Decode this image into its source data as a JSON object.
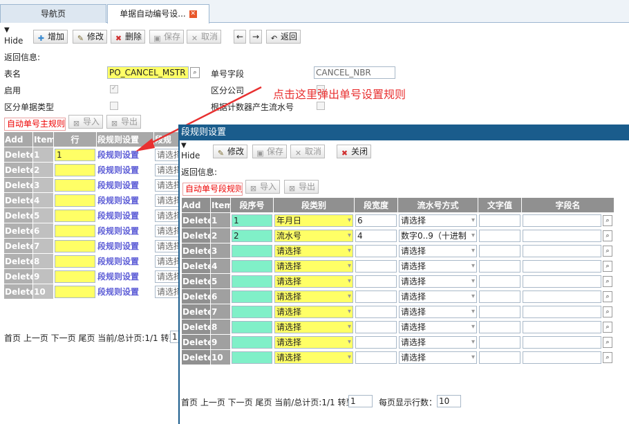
{
  "tabs": [
    {
      "label": "导航页"
    },
    {
      "label": "单据自动编号设..."
    }
  ],
  "toolbar": {
    "hide": "Hide",
    "add": "增加",
    "edit": "修改",
    "delete": "删除",
    "save": "保存",
    "cancel": "取消",
    "back": "返回"
  },
  "form": {
    "return_info": "返回信息:",
    "table_name_label": "表名",
    "table_name_value": "PO_CANCEL_MSTR",
    "number_field_label": "单号字段",
    "number_field_value": "CANCEL_NBR",
    "enabled_label": "启用",
    "distinguish_company_label": "区分公司",
    "distinguish_doc_type_label": "区分单据类型",
    "counter_serial_label": "根据计数器产生流水号"
  },
  "main_subtabs": {
    "auto_rule": "自动单号主规则",
    "import": "导入",
    "export": "导出"
  },
  "main_grid": {
    "headers": [
      "Add",
      "Item",
      "行",
      "段规则设置",
      "段规"
    ],
    "delete_label": "Delete",
    "rule_link": "段规则设置",
    "select_placeholder": "请选择",
    "rows": [
      {
        "item": "1",
        "row": "1"
      },
      {
        "item": "2",
        "row": ""
      },
      {
        "item": "3",
        "row": ""
      },
      {
        "item": "4",
        "row": ""
      },
      {
        "item": "5",
        "row": ""
      },
      {
        "item": "6",
        "row": ""
      },
      {
        "item": "7",
        "row": ""
      },
      {
        "item": "8",
        "row": ""
      },
      {
        "item": "9",
        "row": ""
      },
      {
        "item": "10",
        "row": ""
      }
    ]
  },
  "main_pager": {
    "text": "首页 上一页 下一页 尾页 当前/总计页:1/1 转到",
    "goto": "1"
  },
  "annotation": "点击这里弹出单号设置规则",
  "dialog": {
    "title": "段规则设置",
    "hide": "Hide",
    "edit": "修改",
    "save": "保存",
    "cancel": "取消",
    "close": "关闭",
    "return_info": "返回信息:",
    "subtab_rule": "自动单号段规则",
    "import": "导入",
    "export": "导出",
    "headers": [
      "Add",
      "Item",
      "段序号",
      "段类别",
      "段宽度",
      "流水号方式",
      "文字值",
      "字段名"
    ],
    "delete_label": "Delete",
    "select_placeholder": "请选择",
    "rows": [
      {
        "item": "1",
        "seq": "1",
        "category": "年月日",
        "width": "6",
        "serial_mode": "请选择",
        "text": "",
        "field": ""
      },
      {
        "item": "2",
        "seq": "2",
        "category": "流水号",
        "width": "4",
        "serial_mode": "数字0..9（十进制",
        "text": "",
        "field": ""
      },
      {
        "item": "3",
        "seq": "",
        "category": "请选择",
        "width": "",
        "serial_mode": "请选择",
        "text": "",
        "field": ""
      },
      {
        "item": "4",
        "seq": "",
        "category": "请选择",
        "width": "",
        "serial_mode": "请选择",
        "text": "",
        "field": ""
      },
      {
        "item": "5",
        "seq": "",
        "category": "请选择",
        "width": "",
        "serial_mode": "请选择",
        "text": "",
        "field": ""
      },
      {
        "item": "6",
        "seq": "",
        "category": "请选择",
        "width": "",
        "serial_mode": "请选择",
        "text": "",
        "field": ""
      },
      {
        "item": "7",
        "seq": "",
        "category": "请选择",
        "width": "",
        "serial_mode": "请选择",
        "text": "",
        "field": ""
      },
      {
        "item": "8",
        "seq": "",
        "category": "请选择",
        "width": "",
        "serial_mode": "请选择",
        "text": "",
        "field": ""
      },
      {
        "item": "9",
        "seq": "",
        "category": "请选择",
        "width": "",
        "serial_mode": "请选择",
        "text": "",
        "field": ""
      },
      {
        "item": "10",
        "seq": "",
        "category": "请选择",
        "width": "",
        "serial_mode": "请选择",
        "text": "",
        "field": ""
      }
    ],
    "pager_text": "首页 上一页 下一页 尾页 当前/总计页:1/1 转到",
    "pager_goto": "1",
    "rows_per_page_label": "每页显示行数：",
    "rows_per_page": "10"
  },
  "colors": {
    "dialog_title_bg": "#1a5c8c",
    "annotation": "#e83030",
    "highlight_yellow": "#ffff66",
    "seq_green": "#80f0c8",
    "link_purple": "#5c5cd6"
  }
}
